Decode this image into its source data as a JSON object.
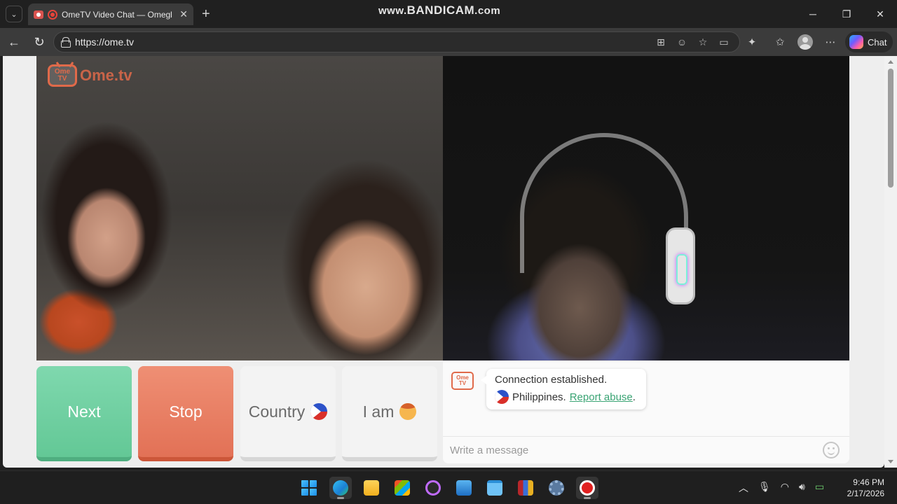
{
  "browser": {
    "tab_title": "OmeTV Video Chat — Omegl",
    "tab_close": "✕",
    "new_tab": "+",
    "watermark_prefix": "www.",
    "watermark_main": "BANDICAM",
    "watermark_suffix": ".com",
    "url": "https://ome.tv",
    "chat_button_label": "Chat"
  },
  "page": {
    "logo_tv_top": "Ome",
    "logo_tv_bottom": "TV",
    "logo_text": "Ome.tv"
  },
  "controls": {
    "next_label": "Next",
    "stop_label": "Stop",
    "country_label": "Country",
    "iam_label": "I am"
  },
  "chat": {
    "logo_top": "Ome",
    "logo_bottom": "TV",
    "status_message": "Connection established.",
    "country": "Philippines.",
    "report_link": "Report abuse",
    "report_suffix": ".",
    "input_placeholder": "Write a message"
  },
  "taskbar": {
    "time": "9:46 PM",
    "date": "2/17/2026"
  },
  "colors": {
    "next_green": "#63c896",
    "stop_red": "#e27156",
    "link_green": "#3aa474",
    "brand_orange": "#e06a4a"
  }
}
